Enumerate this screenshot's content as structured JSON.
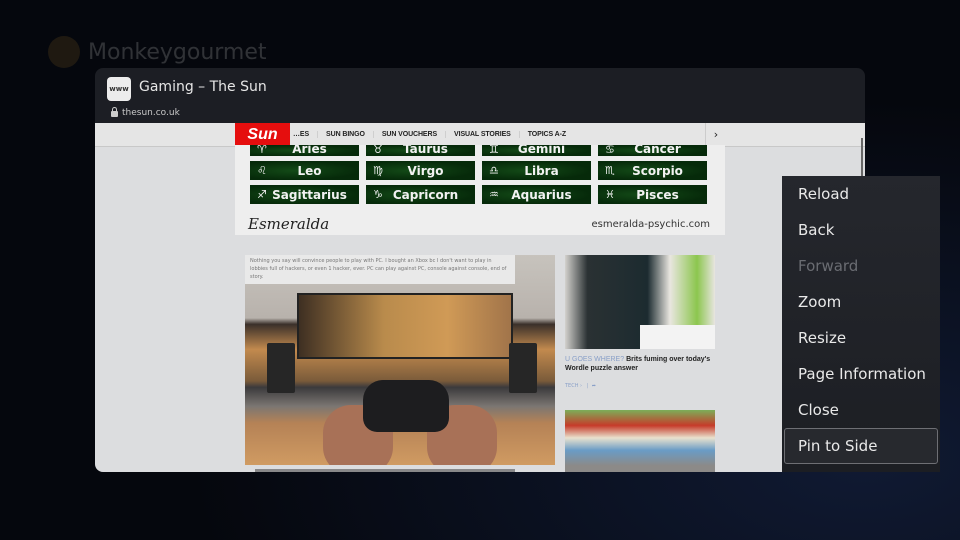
{
  "background": {
    "profile_name": "Monkeygourmet"
  },
  "window": {
    "favicon_label": "www",
    "title": "Gaming – The Sun",
    "url": "thesun.co.uk"
  },
  "page": {
    "logo": "Sun",
    "nav_links": [
      "…ES",
      "SUN BINGO",
      "SUN VOUCHERS",
      "VISUAL STORIES",
      "TOPICS A-Z"
    ],
    "nav_next": "›",
    "ad": {
      "zodiac": [
        {
          "symbol": "♈",
          "name": "Aries"
        },
        {
          "symbol": "♉",
          "name": "Taurus"
        },
        {
          "symbol": "♊",
          "name": "Gemini"
        },
        {
          "symbol": "♋",
          "name": "Cancer"
        },
        {
          "symbol": "♌",
          "name": "Leo"
        },
        {
          "symbol": "♍",
          "name": "Virgo"
        },
        {
          "symbol": "♎",
          "name": "Libra"
        },
        {
          "symbol": "♏",
          "name": "Scorpio"
        },
        {
          "symbol": "♐",
          "name": "Sagittarius"
        },
        {
          "symbol": "♑",
          "name": "Capricorn"
        },
        {
          "symbol": "♒",
          "name": "Aquarius"
        },
        {
          "symbol": "♓",
          "name": "Pisces"
        }
      ],
      "brand": "Esmeralda",
      "website": "esmeralda-psychic.com"
    },
    "main_article": {
      "caption": "Nothing you say will convince people to play with PC. I bought an Xbox bc I don't want to play in lobbies full of hackers, or even 1 hacker, ever. PC can play against PC, console against console, end of story."
    },
    "side_article": {
      "kicker": "U GOES WHERE?",
      "headline": "Brits fuming over today's Wordle puzzle answer",
      "section": "TECH ›",
      "share_icon": "share-icon"
    }
  },
  "context_menu": {
    "items": [
      {
        "label": "Reload",
        "state": "enabled"
      },
      {
        "label": "Back",
        "state": "enabled"
      },
      {
        "label": "Forward",
        "state": "disabled"
      },
      {
        "label": "Zoom",
        "state": "enabled"
      },
      {
        "label": "Resize",
        "state": "enabled"
      },
      {
        "label": "Page Information",
        "state": "enabled"
      },
      {
        "label": "Close",
        "state": "enabled"
      },
      {
        "label": "Pin to Side",
        "state": "focused"
      }
    ]
  }
}
